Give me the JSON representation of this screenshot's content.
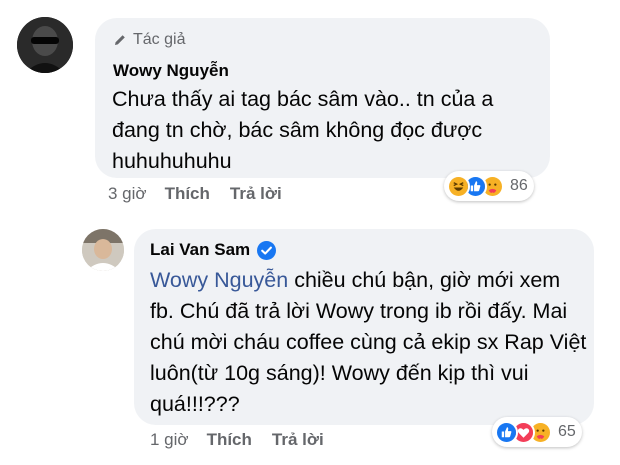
{
  "comment1": {
    "author_badge": "Tác giả",
    "author": "Wowy Nguyễn",
    "text": "Chưa thấy ai tag bác sâm vào.. tn của a đang tn chờ, bác sâm không đọc được huhuhuhuhu",
    "time": "3 giờ",
    "like": "Thích",
    "reply": "Trả lời",
    "reactions": [
      "haha-icon",
      "like-icon",
      "care-icon"
    ],
    "reaction_count": "86"
  },
  "comment2": {
    "author": "Lai Van Sam",
    "mention": "Wowy Nguyễn",
    "text": " chiều chú bận, giờ mới xem fb. Chú đã trả lời Wowy trong ib rồi đấy. Mai chú mời cháu coffee cùng cả ekip sx Rap Việt luôn(từ 10g sáng)! Wowy đến kịp thì vui quá!!!???",
    "time": "1 giờ",
    "like": "Thích",
    "reply": "Trả lời",
    "reactions": [
      "like-icon",
      "love-icon",
      "care-icon"
    ],
    "reaction_count": "65"
  },
  "colors": {
    "bubble": "#f0f2f5",
    "meta": "#65676b",
    "mention": "#385898",
    "like_blue": "#1877f2",
    "love_red": "#f33e58",
    "haha_yellow": "#f7b125"
  }
}
